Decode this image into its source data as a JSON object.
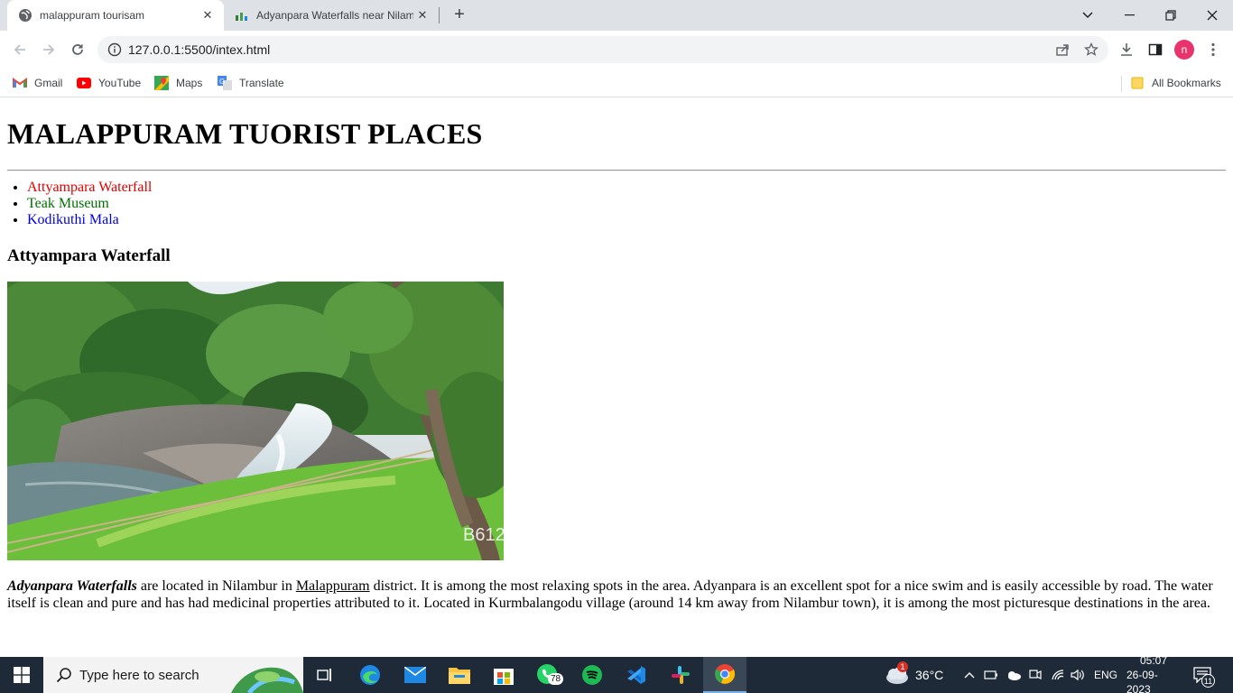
{
  "browser": {
    "tabs": [
      {
        "title": "malappuram tourisam",
        "close": "✕"
      },
      {
        "title": "Adyanpara Waterfalls near Nilam",
        "close": "✕"
      }
    ],
    "new_tab": "+",
    "address": "127.0.0.1:5500/intex.html",
    "profile_initial": "n",
    "bookmarks": [
      {
        "label": "Gmail",
        "icon": "gmail-icon"
      },
      {
        "label": "YouTube",
        "icon": "youtube-icon"
      },
      {
        "label": "Maps",
        "icon": "maps-icon"
      },
      {
        "label": "Translate",
        "icon": "translate-icon"
      }
    ],
    "all_bookmarks": "All Bookmarks"
  },
  "page": {
    "heading": "MALAPPURAM TUORIST PLACES",
    "places": [
      {
        "label": "Attyampara Waterfall",
        "color": "#e00000"
      },
      {
        "label": "Teak Museum",
        "color": "#007000"
      },
      {
        "label": "Kodikuthi Mala",
        "color": "#0000e0"
      }
    ],
    "section_title": "Attyampara Waterfall",
    "image_watermark": "B612",
    "description": {
      "lead": "Adyanpara Waterfalls",
      "part1": " are located in Nilambur in ",
      "link": "Malappuram",
      "part2": " district. It is among the most relaxing spots in the area. Adyanpara is an excellent spot for a nice swim and is easily accessible by road. The water itself is clean and pure and has had medicinal properties attributed to it. Located in Kurmbalangodu village (around 14 km away from Nilambur town), it is among the most picturesque destinations in the area."
    }
  },
  "taskbar": {
    "search_placeholder": "Type here to search",
    "whatsapp_badge": "78",
    "weather_badge": "1",
    "temperature": "36°C",
    "language": "ENG",
    "time": "05:07",
    "date": "26-09-2023",
    "notifications": "11"
  }
}
